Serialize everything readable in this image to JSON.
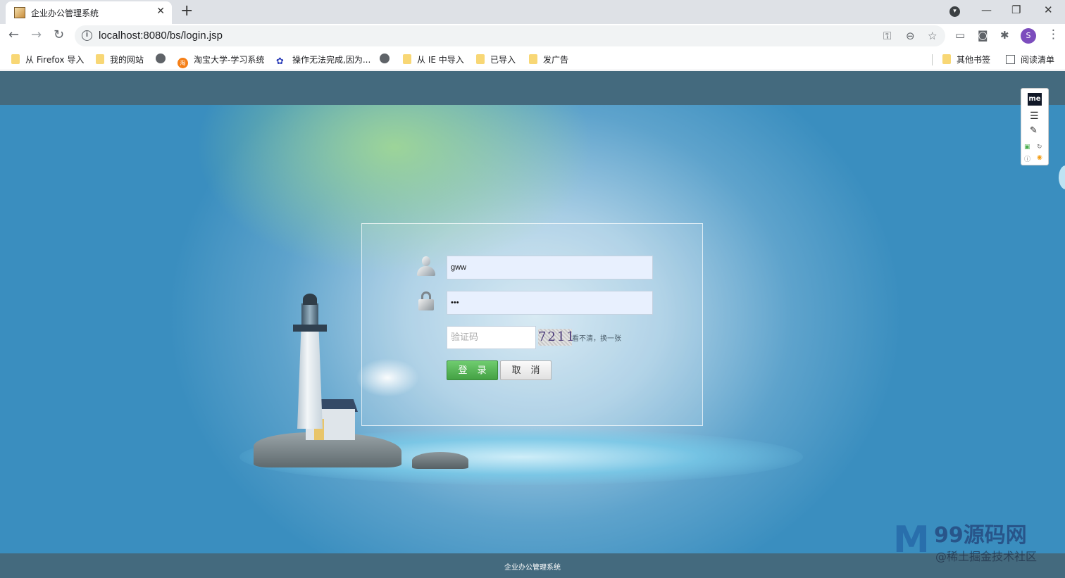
{
  "browser": {
    "tab_title": "企业办公管理系统",
    "tab_close": "✕",
    "new_tab": "+",
    "url": "localhost:8080/bs/login.jsp",
    "profile_initial": "S",
    "win_minimize": "—",
    "win_restore": "❐",
    "win_close": "✕",
    "back": "←",
    "forward": "→",
    "reload": "↻",
    "menu": "⋮",
    "key_icon": "⚿",
    "zoom_icon": "⊖",
    "star_icon": "☆",
    "extensions_icon": "✱",
    "camera_icon": "◙",
    "cast_icon": "▭"
  },
  "bookmarks": [
    {
      "label": "从 Firefox 导入",
      "icon": "folder-icon"
    },
    {
      "label": "我的网站",
      "icon": "folder-icon"
    },
    {
      "label": "",
      "icon": "globe-icon"
    },
    {
      "label": "淘宝大学-学习系统",
      "icon": "taobao-icon"
    },
    {
      "label": "操作无法完成,因为...",
      "icon": "paw-icon"
    },
    {
      "label": "",
      "icon": "globe-icon"
    },
    {
      "label": "从 IE 中导入",
      "icon": "folder-icon"
    },
    {
      "label": "已导入",
      "icon": "folder-icon"
    },
    {
      "label": "发广告",
      "icon": "folder-icon"
    },
    {
      "label": "其他书签",
      "icon": "folder-icon"
    },
    {
      "label": "阅读清单",
      "icon": "reader-icon"
    }
  ],
  "login": {
    "username_value": "gww",
    "password_value": "•••",
    "captcha_placeholder": "验证码",
    "captcha_code": "7211",
    "captcha_refresh": "看不清，换一张",
    "login_button": "登录",
    "cancel_button": "取消"
  },
  "footer": {
    "text": "企业办公管理系统"
  },
  "extension_panel": {
    "logo": "me",
    "menu_glyph": "☰",
    "wand_glyph": "✎"
  },
  "watermark": {
    "logo": "M",
    "brand": "99源码网",
    "sub": "@稀土掘金技术社区"
  }
}
